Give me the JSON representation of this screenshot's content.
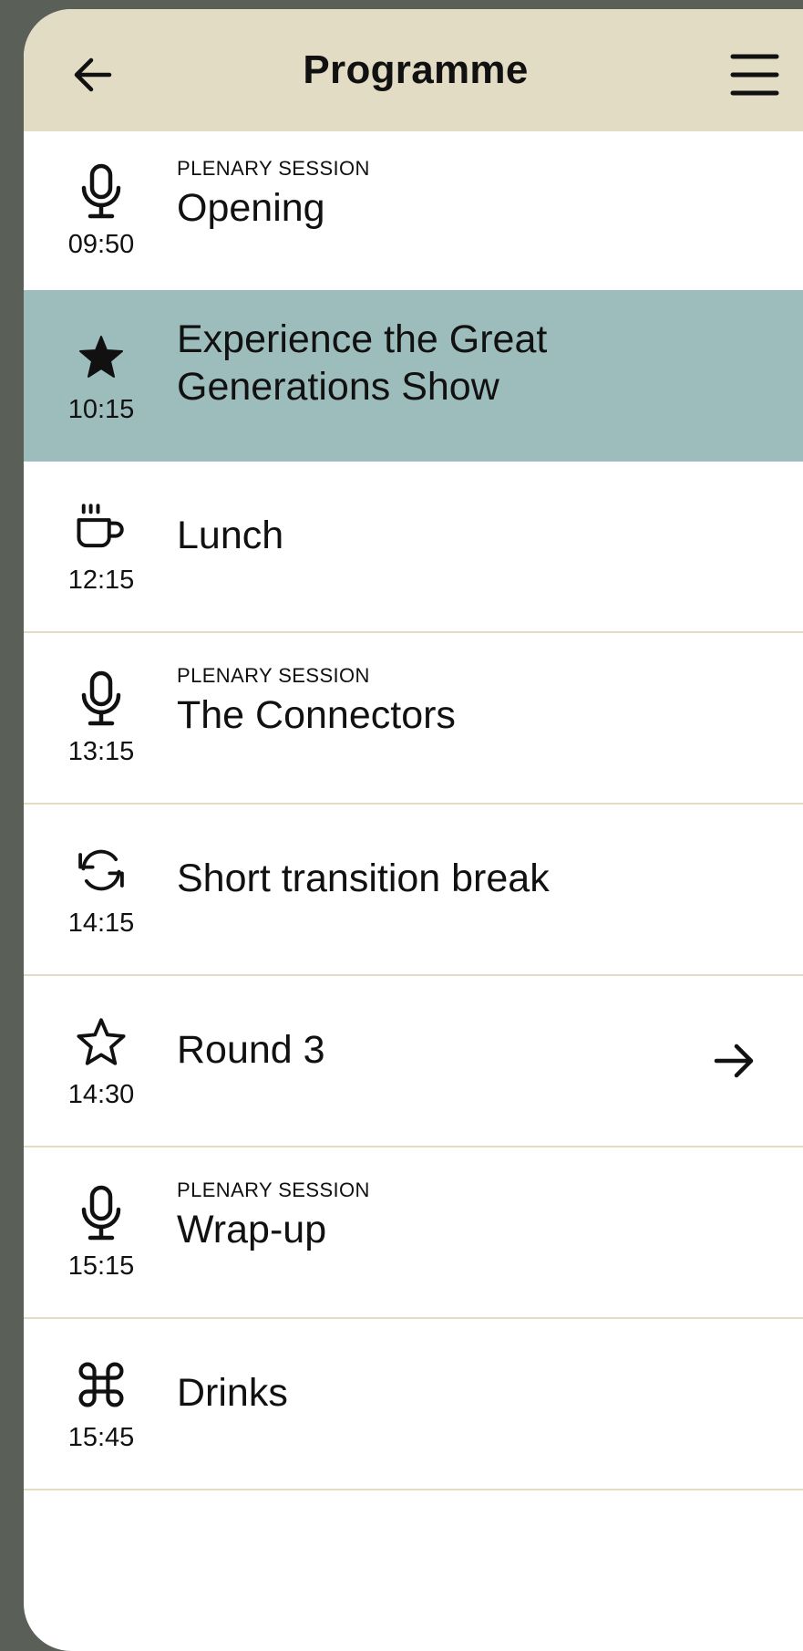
{
  "header": {
    "title": "Programme",
    "back_icon": "arrow-left-icon",
    "menu_icon": "hamburger-menu-icon",
    "background": "#e2dcc5"
  },
  "colors": {
    "highlight_row": "#9dbcbc",
    "divider": "#e2dcc5",
    "outer_background": "#5a6058"
  },
  "programme": {
    "items": [
      {
        "time": "09:50",
        "icon": "microphone-icon",
        "kicker": "PLENARY SESSION",
        "title": "Opening",
        "highlighted": false
      },
      {
        "time": "10:15",
        "icon": "star-filled-icon",
        "kicker": "",
        "title": "Experience the Great Generations Show",
        "highlighted": true
      },
      {
        "time": "12:15",
        "icon": "coffee-cup-icon",
        "kicker": "",
        "title": "Lunch",
        "highlighted": false
      },
      {
        "time": "13:15",
        "icon": "microphone-icon",
        "kicker": "PLENARY SESSION",
        "title": "The Connectors",
        "highlighted": false
      },
      {
        "time": "14:15",
        "icon": "refresh-icon",
        "kicker": "",
        "title": "Short transition break",
        "highlighted": false
      },
      {
        "time": "14:30",
        "icon": "star-outline-icon",
        "kicker": "",
        "title": "Round 3",
        "highlighted": false,
        "trailing_icon": "arrow-right-icon"
      },
      {
        "time": "15:15",
        "icon": "microphone-icon",
        "kicker": "PLENARY SESSION",
        "title": "Wrap-up",
        "highlighted": false
      },
      {
        "time": "15:45",
        "icon": "command-icon",
        "kicker": "",
        "title": "Drinks",
        "highlighted": false
      }
    ]
  }
}
